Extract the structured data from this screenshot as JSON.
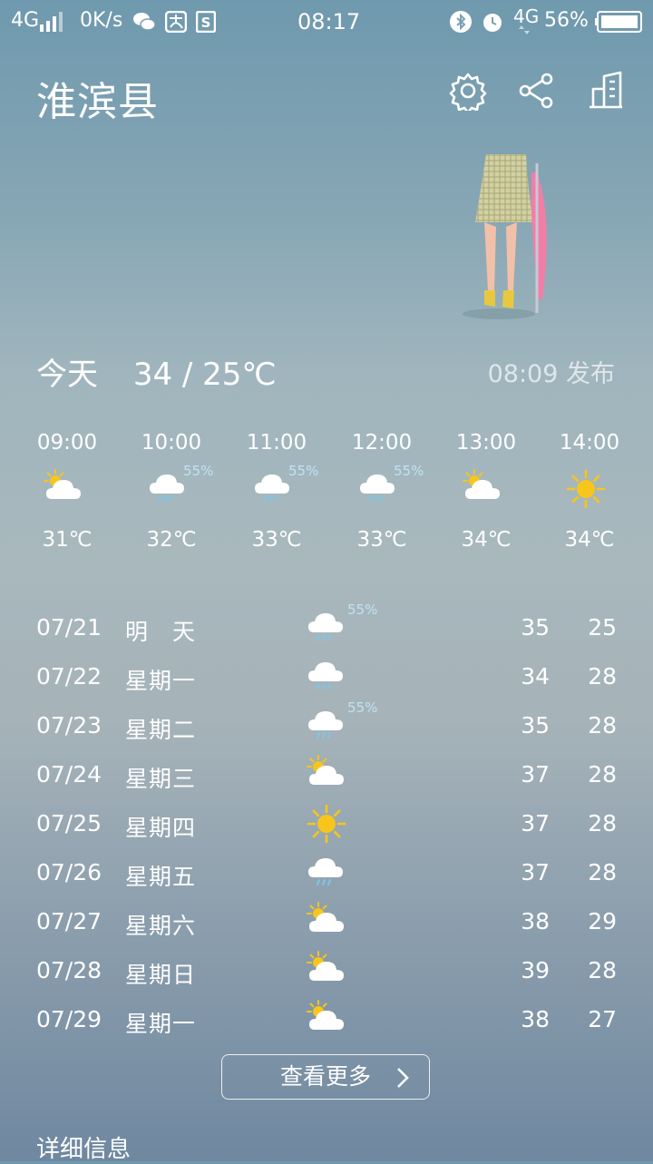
{
  "status_bar": {
    "network": "4G",
    "speed": "0K/s",
    "time": "08:17",
    "network2": "4G",
    "battery": "56%",
    "icons": [
      "signal-icon",
      "wechat-icon",
      "alipay-icon",
      "s-app-icon",
      "bluetooth-icon",
      "alarm-icon",
      "battery-icon"
    ]
  },
  "header": {
    "city": "淮滨县",
    "icons": [
      "settings-gear-icon",
      "share-icon",
      "city-manage-icon"
    ]
  },
  "today": {
    "label": "今天",
    "temps": "34 / 25℃",
    "published": "08:09 发布"
  },
  "hourly": [
    {
      "time": "09:00",
      "icon": "partly-cloudy-icon",
      "pct": "",
      "temp": "31℃"
    },
    {
      "time": "10:00",
      "icon": "rain-cloud-icon",
      "pct": "55%",
      "temp": "32℃"
    },
    {
      "time": "11:00",
      "icon": "rain-cloud-icon",
      "pct": "55%",
      "temp": "33℃"
    },
    {
      "time": "12:00",
      "icon": "rain-cloud-icon",
      "pct": "55%",
      "temp": "33℃"
    },
    {
      "time": "13:00",
      "icon": "partly-cloudy-icon",
      "pct": "",
      "temp": "34℃"
    },
    {
      "time": "14:00",
      "icon": "sun-icon",
      "pct": "",
      "temp": "34℃"
    }
  ],
  "daily": [
    {
      "date": "07/21",
      "day": "明　天",
      "icon": "rain-cloud-icon",
      "pct": "55%",
      "hi": "35",
      "lo": "25"
    },
    {
      "date": "07/22",
      "day": "星期一",
      "icon": "rain-cloud-icon",
      "pct": "",
      "hi": "34",
      "lo": "28"
    },
    {
      "date": "07/23",
      "day": "星期二",
      "icon": "rain-cloud-icon",
      "pct": "55%",
      "hi": "35",
      "lo": "28"
    },
    {
      "date": "07/24",
      "day": "星期三",
      "icon": "partly-cloudy-icon",
      "pct": "",
      "hi": "37",
      "lo": "28"
    },
    {
      "date": "07/25",
      "day": "星期四",
      "icon": "sun-icon",
      "pct": "",
      "hi": "37",
      "lo": "28"
    },
    {
      "date": "07/26",
      "day": "星期五",
      "icon": "rain-cloud-icon",
      "pct": "",
      "hi": "37",
      "lo": "28"
    },
    {
      "date": "07/27",
      "day": "星期六",
      "icon": "partly-cloudy-icon",
      "pct": "",
      "hi": "38",
      "lo": "29"
    },
    {
      "date": "07/28",
      "day": "星期日",
      "icon": "partly-cloudy-icon",
      "pct": "",
      "hi": "39",
      "lo": "28"
    },
    {
      "date": "07/29",
      "day": "星期一",
      "icon": "partly-cloudy-icon",
      "pct": "",
      "hi": "38",
      "lo": "27"
    }
  ],
  "more_button": "查看更多",
  "detail_title": "详细信息",
  "colors": {
    "sun": "#f7c51c",
    "rain": "#7cc7ea",
    "pct": "#bfe3f3"
  }
}
